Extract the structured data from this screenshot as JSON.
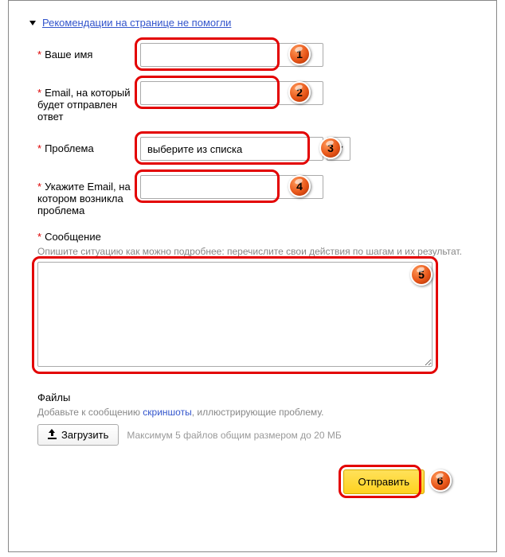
{
  "collapse_link": "Рекомендации на странице не помогли",
  "fields": {
    "name": {
      "label": "Ваше имя"
    },
    "email": {
      "label": "Email, на который будет отправлен ответ"
    },
    "problem": {
      "label": "Проблема",
      "placeholder": "выберите из списка"
    },
    "account_email": {
      "label": "Укажите Email, на котором возникла проблема"
    }
  },
  "message": {
    "label": "Сообщение",
    "hint": "Опишите ситуацию как можно подробнее: перечислите свои действия по шагам и их результат."
  },
  "files": {
    "label": "Файлы",
    "hint_prefix": "Добавьте к сообщению ",
    "hint_link": "скриншоты",
    "hint_suffix": ", иллюстрирующие проблему.",
    "upload_label": "Загрузить",
    "limit": "Максимум 5 файлов общим размером до 20 МБ"
  },
  "submit_label": "Отправить",
  "badges": {
    "b1": "1",
    "b2": "2",
    "b3": "3",
    "b4": "4",
    "b5": "5",
    "b6": "6"
  },
  "required_mark": "*"
}
